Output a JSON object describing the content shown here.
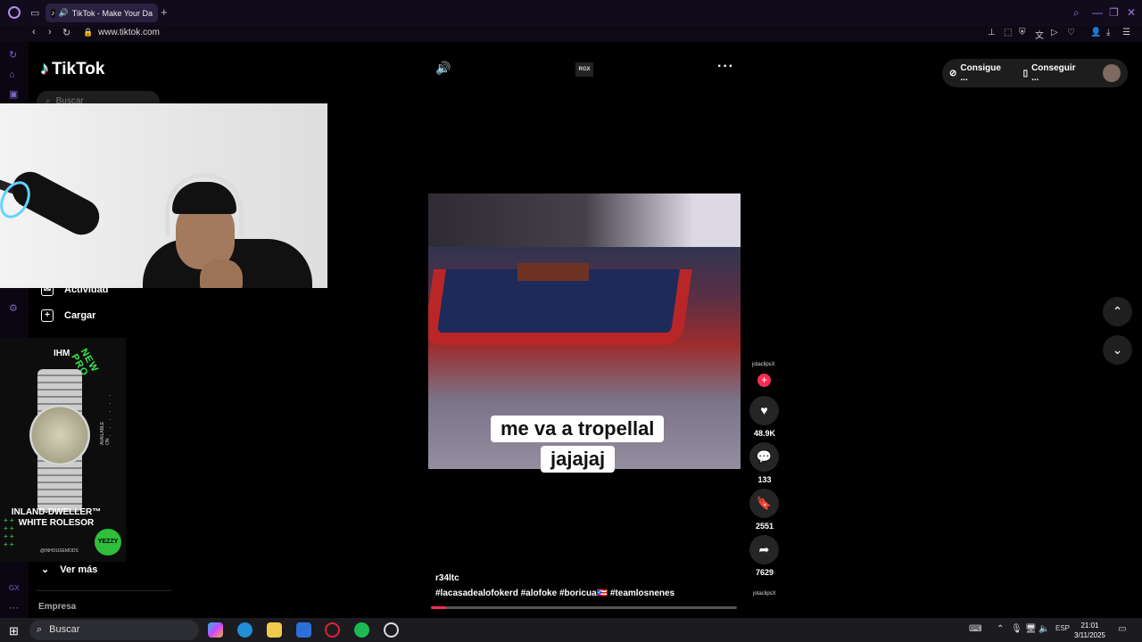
{
  "browser": {
    "tab_title": "TikTok - Make Your Da",
    "url": "www.tiktok.com"
  },
  "tiktok": {
    "logo": "TikTok",
    "search_placeholder": "Buscar",
    "nav": [
      {
        "label": "Actividad",
        "icon": "activity-icon"
      },
      {
        "label": "Cargar",
        "icon": "upload-icon"
      }
    ],
    "ver_mas": "Ver más",
    "empresa": "Empresa",
    "top_right": {
      "coins": "Consigue ...",
      "app": "Conseguir ..."
    },
    "rgx": "RGX",
    "subtitle_line1": "me va a tropellal",
    "subtitle_line2": "jajajaj",
    "author": "r34ltc",
    "tags": "#lacasadealofokerd  #alofoke  #boricua🇵🇷  #teamlosnenes",
    "progress_fraction": 0.05,
    "creator_handle": "jotaclipsX",
    "creator_handle_bottom": "jotaclipsX",
    "likes": "48.9K",
    "comments": "133",
    "saves": "2551",
    "shares": "7629"
  },
  "ad": {
    "brand": "IHM",
    "tagline": "NEW PRO",
    "title": "INLAND-DWELLER™ WHITE ROLESOR",
    "handle": "@INHOUSEMODS",
    "available": "AVAILABLE ON",
    "badge": "YEZZY"
  },
  "taskbar": {
    "search": "Buscar",
    "lang": "ESP",
    "time": "21:01",
    "date": "3/11/2025"
  },
  "colors": {
    "accent": "#fe2c55",
    "opera": "#9c79e0"
  }
}
